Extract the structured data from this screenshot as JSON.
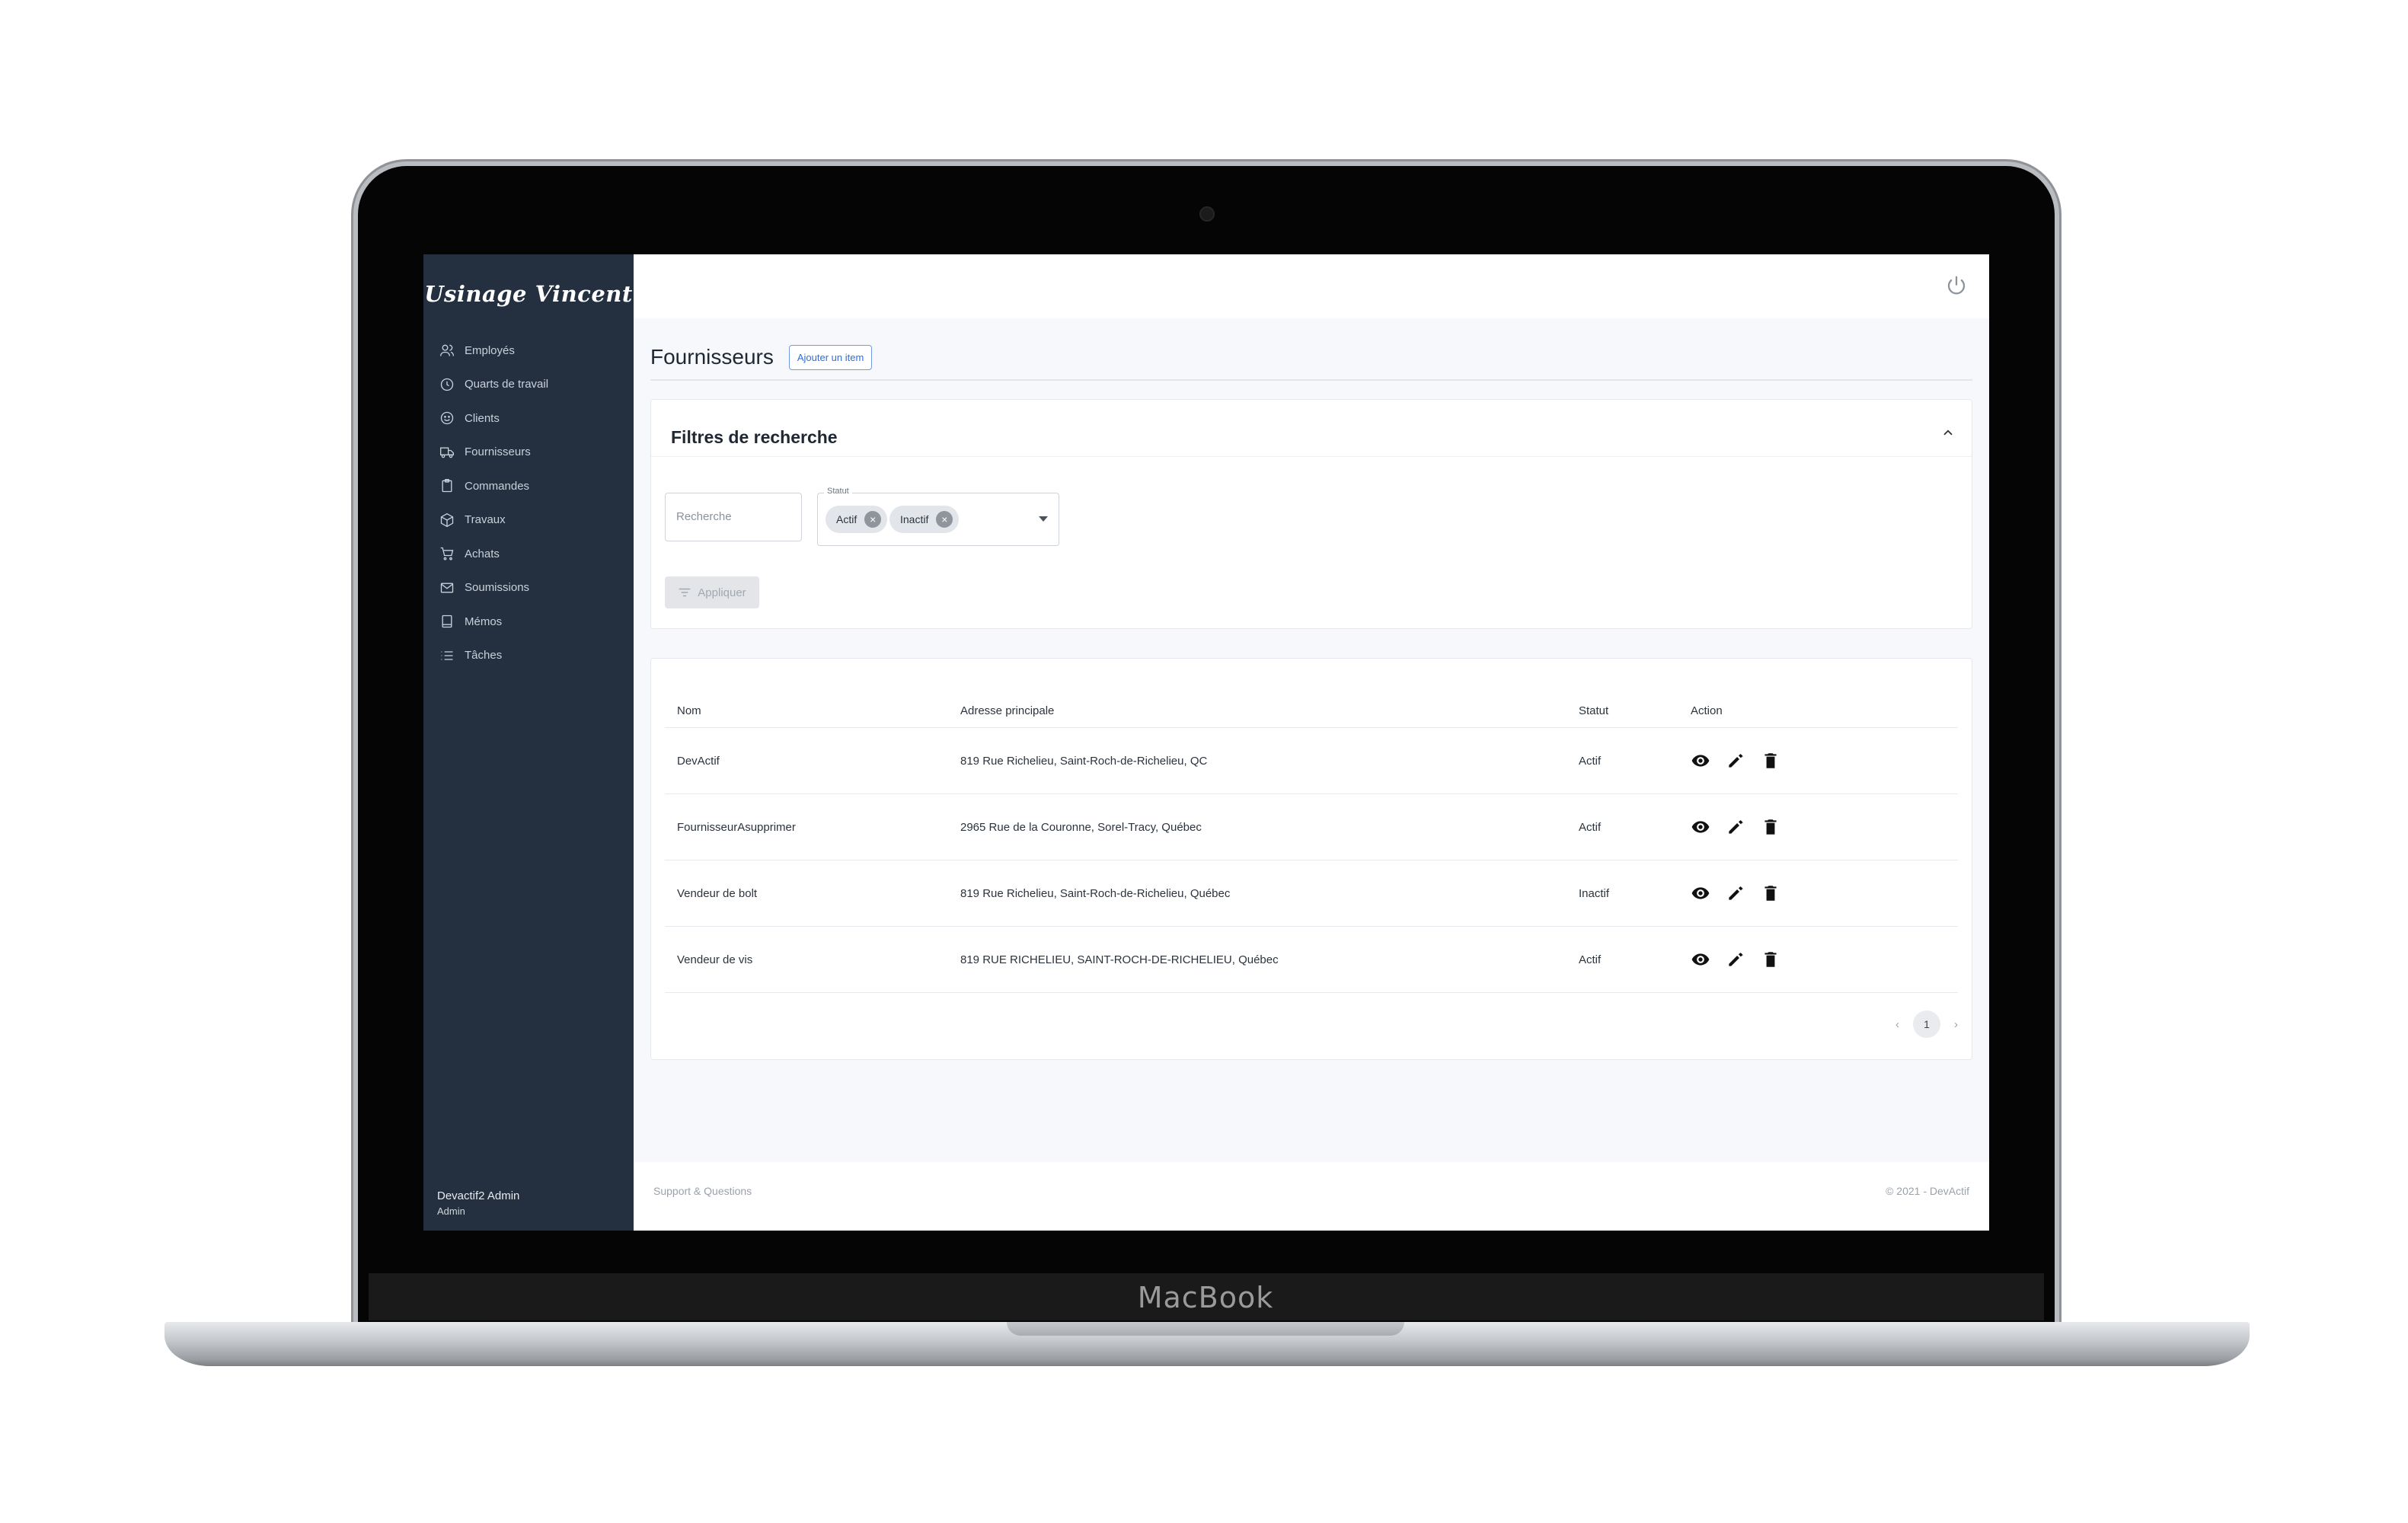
{
  "device": {
    "brand": "MacBook"
  },
  "app": {
    "logo": "Usinage Vincent"
  },
  "sidebar": {
    "items": [
      {
        "label": "Employés",
        "icon": "users-icon"
      },
      {
        "label": "Quarts de travail",
        "icon": "clock-icon"
      },
      {
        "label": "Clients",
        "icon": "smile-icon"
      },
      {
        "label": "Fournisseurs",
        "icon": "truck-icon"
      },
      {
        "label": "Commandes",
        "icon": "clipboard-icon"
      },
      {
        "label": "Travaux",
        "icon": "box-icon"
      },
      {
        "label": "Achats",
        "icon": "cart-icon"
      },
      {
        "label": "Soumissions",
        "icon": "mail-icon"
      },
      {
        "label": "Mémos",
        "icon": "book-icon"
      },
      {
        "label": "Tâches",
        "icon": "list-icon"
      }
    ],
    "user": {
      "name": "Devactif2 Admin",
      "role": "Admin"
    }
  },
  "header": {
    "title": "Fournisseurs",
    "add_button": "Ajouter un item"
  },
  "filters": {
    "title": "Filtres de recherche",
    "search_placeholder": "Recherche",
    "status_label": "Statut",
    "status_chips": [
      "Actif",
      "Inactif"
    ],
    "apply_button": "Appliquer"
  },
  "table": {
    "headers": {
      "name": "Nom",
      "address": "Adresse principale",
      "status": "Statut",
      "action": "Action"
    },
    "rows": [
      {
        "name": "DevActif",
        "address": "819 Rue Richelieu, Saint-Roch-de-Richelieu, QC",
        "status": "Actif"
      },
      {
        "name": "FournisseurAsupprimer",
        "address": "2965 Rue de la Couronne, Sorel-Tracy, Québec",
        "status": "Actif"
      },
      {
        "name": "Vendeur de bolt",
        "address": "819 Rue Richelieu, Saint-Roch-de-Richelieu, Québec",
        "status": "Inactif"
      },
      {
        "name": "Vendeur de vis",
        "address": "819 RUE RICHELIEU, SAINT-ROCH-DE-RICHELIEU, Québec",
        "status": "Actif"
      }
    ],
    "pagination": {
      "current_page": "1"
    }
  },
  "footer": {
    "left": "Support & Questions",
    "right": "© 2021 - DevActif"
  },
  "colors": {
    "sidebar": "#24303f",
    "accent": "#2f6fd6",
    "background": "#f6f8fb"
  }
}
